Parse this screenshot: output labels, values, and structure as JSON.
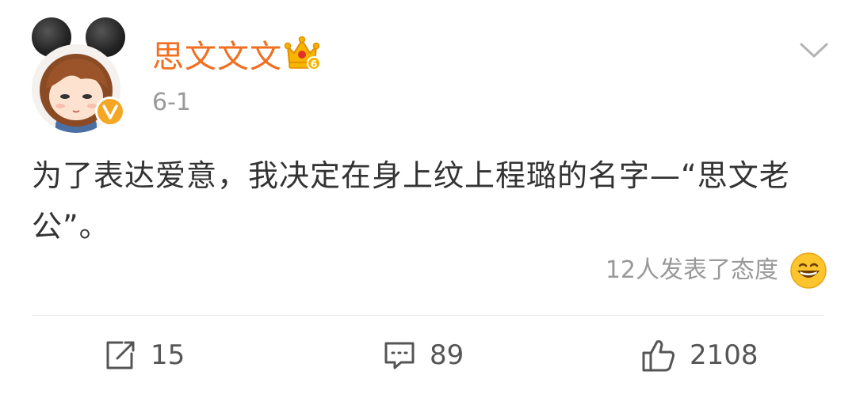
{
  "author": {
    "name": "思文文文",
    "avatar_icon": "cartoon-girl-mouse-ears-avatar",
    "verified_icon": "verified-v-badge",
    "vip_icon": "vip-crown-level-6",
    "vip_level": "6"
  },
  "post": {
    "date": "6-1",
    "text": "为了表达爱意，我决定在身上纹上程璐的名字—“思文老公”。"
  },
  "reactions": {
    "text": "12人发表了态度",
    "emoji_icon": "grinning-face-emoji"
  },
  "actions": {
    "repost": {
      "icon": "repost-icon",
      "count": "15"
    },
    "comment": {
      "icon": "comment-icon",
      "count": "89"
    },
    "like": {
      "icon": "thumbs-up-icon",
      "count": "2108"
    }
  },
  "menu": {
    "icon": "chevron-down-icon"
  },
  "colors": {
    "username": "#f26f21",
    "secondary_text": "#999999",
    "body_text": "#333333",
    "verified": "#f5a623",
    "vip_crown": "#f7b500",
    "divider": "#e6e6e6"
  }
}
